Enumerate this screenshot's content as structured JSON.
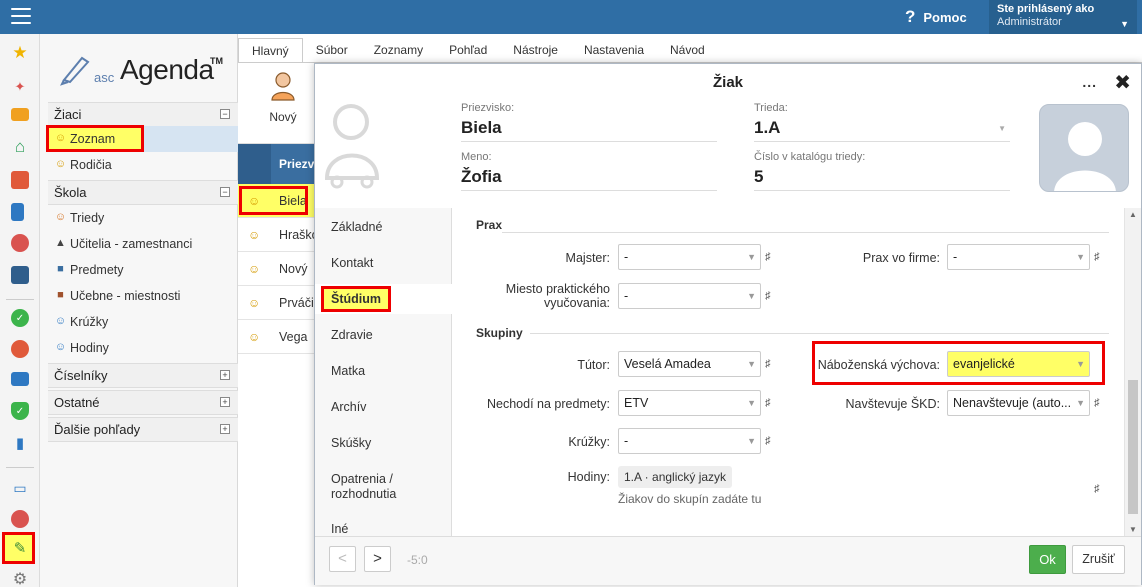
{
  "topbar": {
    "help_label": "Pomoc",
    "help_icon": "question-icon",
    "user_line1": "Ste prihlásený ako",
    "user_line2": "Administrátor"
  },
  "logo": {
    "asc": "asc",
    "name": "Agenda",
    "tm": "TM"
  },
  "nav": {
    "sections": [
      {
        "label": "Žiaci",
        "toggle": "−"
      },
      {
        "label": "Škola",
        "toggle": "−"
      },
      {
        "label": "Číselníky",
        "toggle": "+"
      },
      {
        "label": "Ostatné",
        "toggle": "+"
      },
      {
        "label": "Ďalšie pohľady",
        "toggle": "+"
      }
    ],
    "items": [
      {
        "label": "Zoznam",
        "icon": "student-icon"
      },
      {
        "label": "Rodičia",
        "icon": "parents-icon"
      },
      {
        "label": "Triedy",
        "icon": "class-icon"
      },
      {
        "label": "Učitelia - zamestnanci",
        "icon": "teacher-icon"
      },
      {
        "label": "Predmety",
        "icon": "subject-icon"
      },
      {
        "label": "Učebne - miestnosti",
        "icon": "room-icon"
      },
      {
        "label": "Krúžky",
        "icon": "club-icon"
      },
      {
        "label": "Hodiny",
        "icon": "lessons-icon"
      }
    ]
  },
  "ribbon": {
    "tabs": [
      "Hlavný",
      "Súbor",
      "Zoznamy",
      "Pohľad",
      "Nástroje",
      "Nastavenia",
      "Návod"
    ],
    "new_label": "Nový"
  },
  "grid": {
    "header": "Priezv",
    "rows": [
      "Biela",
      "Hraško",
      "Nový",
      "Prváči",
      "Vega"
    ]
  },
  "dialog": {
    "title": "Žiak",
    "more": "...",
    "close": "✖",
    "surname_label": "Priezvisko:",
    "surname": "Biela",
    "name_label": "Meno:",
    "name": "Žofia",
    "class_label": "Trieda:",
    "class": "1.A",
    "catalog_label": "Číslo v katalógu triedy:",
    "catalog": "5",
    "side_tabs": [
      "Základné",
      "Kontakt",
      "Štúdium",
      "Zdravie",
      "Matka",
      "Archív",
      "Skúšky",
      "Opatrenia / rozhodnutia",
      "Iné"
    ],
    "prax": {
      "title": "Prax",
      "master_label": "Majster:",
      "master_value": "-",
      "firm_label": "Prax vo firme:",
      "firm_value": "-",
      "place_label_1": "Miesto praktického",
      "place_label_2": "vyučovania:",
      "place_value": "-"
    },
    "groups": {
      "title": "Skupiny",
      "tutor_label": "Tútor:",
      "tutor_value": "Veselá Amadea",
      "religion_label": "Náboženská výchova:",
      "religion_value": "evanjelické",
      "notgo_label": "Nechodí na predmety:",
      "notgo_value": "ETV",
      "skd_label": "Navštevuje ŠKD:",
      "skd_value": "Nenavštevuje (auto...",
      "clubs_label": "Krúžky:",
      "clubs_value": "-",
      "hours_label": "Hodiny:",
      "hours_chip": "1.A · anglický jazyk",
      "hint": "Žiakov do skupín zadáte tu",
      "hash": "♯"
    },
    "footer": {
      "prev": "<",
      "next": ">",
      "counter": "-5:0",
      "ok": "Ok",
      "cancel": "Zrušiť"
    }
  },
  "colors": {
    "topbar": "#2f6ea5",
    "highlight": "#ffff66",
    "annotation": "#ee0000",
    "ok": "#4cae4c"
  }
}
